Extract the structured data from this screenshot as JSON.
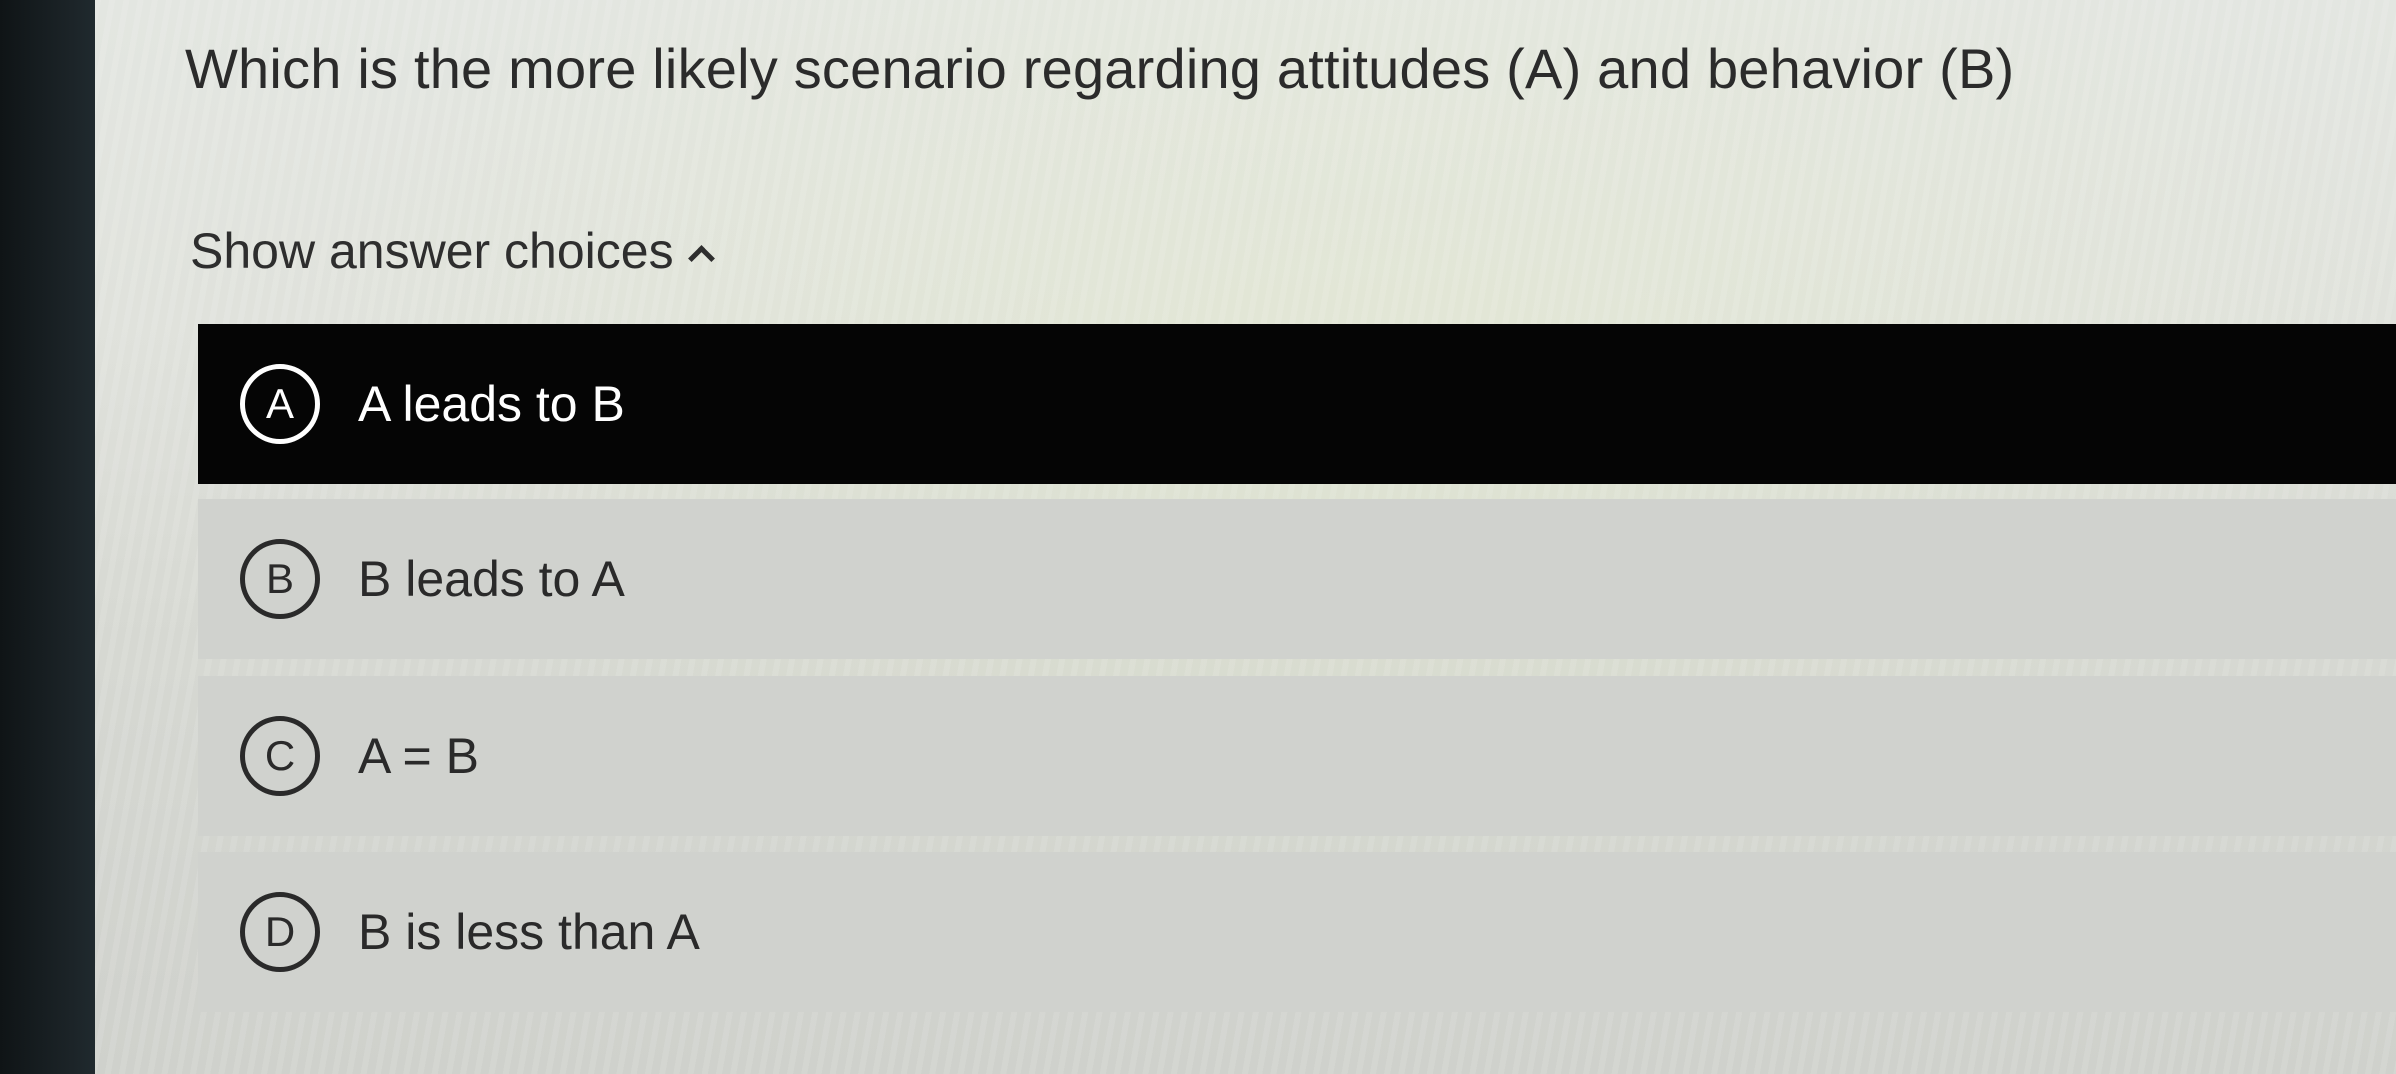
{
  "question": {
    "text": "Which is the more likely scenario regarding attitudes (A) and behavior (B)"
  },
  "toggle": {
    "label": "Show answer choices",
    "icon": "chevron-up-icon",
    "expanded": true
  },
  "choices": [
    {
      "letter": "A",
      "label": "A leads to B",
      "selected": true
    },
    {
      "letter": "B",
      "label": "B leads to A",
      "selected": false
    },
    {
      "letter": "C",
      "label": "A = B",
      "selected": false
    },
    {
      "letter": "D",
      "label": "B is less than A",
      "selected": false
    }
  ],
  "colors": {
    "selected_background": "#050505",
    "option_background": "#d0d2ce",
    "page_background": "#e0e2dc",
    "text": "#2a2a2a"
  }
}
